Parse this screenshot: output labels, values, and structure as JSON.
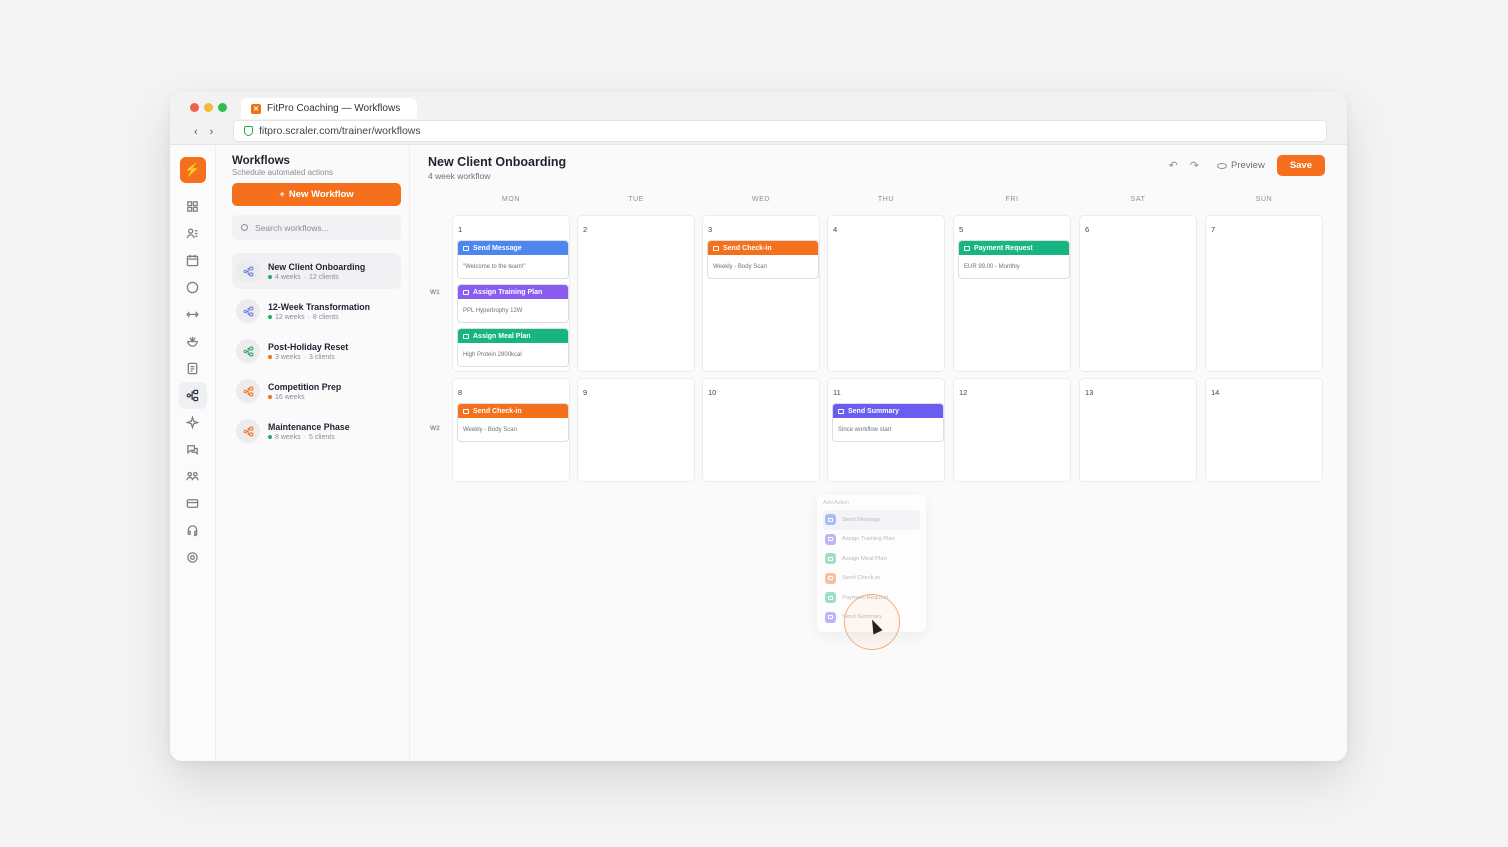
{
  "browser": {
    "tab_title": "FitPro Coaching — Workflows",
    "url": "fitpro.scraler.com/trainer/workflows"
  },
  "rail": {
    "icons": [
      "dashboard-icon",
      "clients-icon",
      "calendar-icon",
      "messages-icon",
      "dumbbell-icon",
      "nutrition-icon",
      "checklist-icon",
      "workflows-icon",
      "ai-sparkle-icon",
      "chat-icon",
      "community-icon",
      "billing-icon",
      "support-icon",
      "settings-icon"
    ],
    "active": "workflows-icon"
  },
  "sidebar": {
    "title": "Workflows",
    "subtitle": "Schedule automated actions",
    "new_button": "New Workflow",
    "search_placeholder": "Search workflows...",
    "items": [
      {
        "name": "New Client Onboarding",
        "weeks": "4 weeks",
        "clients": "12 clients",
        "status_color": "#2aa862",
        "icon_color": "#6b7ee0",
        "active": true
      },
      {
        "name": "12-Week Transformation",
        "weeks": "12 weeks",
        "clients": "8 clients",
        "status_color": "#2aa862",
        "icon_color": "#6b7ee0",
        "active": false
      },
      {
        "name": "Post-Holiday Reset",
        "weeks": "3 weeks",
        "clients": "3 clients",
        "status_color": "#f4701c",
        "icon_color": "#2aa862",
        "active": false
      },
      {
        "name": "Competition Prep",
        "weeks": "16 weeks",
        "clients": "",
        "status_color": "#f4701c",
        "icon_color": "#f4701c",
        "active": false
      },
      {
        "name": "Maintenance Phase",
        "weeks": "8 weeks",
        "clients": "5 clients",
        "status_color": "#2aa862",
        "icon_color": "#f4701c",
        "active": false
      }
    ]
  },
  "main": {
    "title": "New Client Onboarding",
    "subtitle": "4 week workflow",
    "preview_label": "Preview",
    "save_label": "Save",
    "days_of_week": [
      "MON",
      "TUE",
      "WED",
      "THU",
      "FRI",
      "SAT",
      "SUN"
    ],
    "weeks": [
      {
        "label": "W1",
        "days": [
          "1",
          "2",
          "3",
          "4",
          "5",
          "6",
          "7"
        ]
      },
      {
        "label": "W2",
        "days": [
          "8",
          "9",
          "10",
          "11",
          "12",
          "13",
          "14"
        ]
      }
    ],
    "actions": [
      {
        "week": 0,
        "day": 0,
        "slot": 0,
        "title": "Send Message",
        "detail": "\"Welcome to the team!\"",
        "color": "#4e86f0"
      },
      {
        "week": 0,
        "day": 0,
        "slot": 1,
        "title": "Assign Training Plan",
        "detail": "PPL Hypertrophy 12W",
        "color": "#8b5cf0"
      },
      {
        "week": 0,
        "day": 0,
        "slot": 2,
        "title": "Assign Meal Plan",
        "detail": "High Protein 2800kcal",
        "color": "#17b582"
      },
      {
        "week": 0,
        "day": 2,
        "slot": 0,
        "title": "Send Check-in",
        "detail": "Weekly - Body Scan",
        "color": "#f4701c"
      },
      {
        "week": 0,
        "day": 4,
        "slot": 0,
        "title": "Payment Request",
        "detail": "EUR 99.00 - Monthly",
        "color": "#17b582"
      },
      {
        "week": 1,
        "day": 0,
        "slot": 0,
        "title": "Send Check-in",
        "detail": "Weekly - Body Scan",
        "color": "#f4701c"
      },
      {
        "week": 1,
        "day": 3,
        "slot": 0,
        "title": "Send Summary",
        "detail": "Since workflow start",
        "color": "#6a5ef0"
      }
    ],
    "add_action_menu": {
      "title": "Add Action",
      "items": [
        {
          "label": "Send Message",
          "color": "#8fa6f5"
        },
        {
          "label": "Assign Training Plan",
          "color": "#b59af5"
        },
        {
          "label": "Assign Meal Plan",
          "color": "#7fd6b6"
        },
        {
          "label": "Send Check-in",
          "color": "#f7ad80"
        },
        {
          "label": "Payment Request",
          "color": "#7fd6b6"
        },
        {
          "label": "Send Summary",
          "color": "#a99ff5"
        }
      ]
    }
  }
}
